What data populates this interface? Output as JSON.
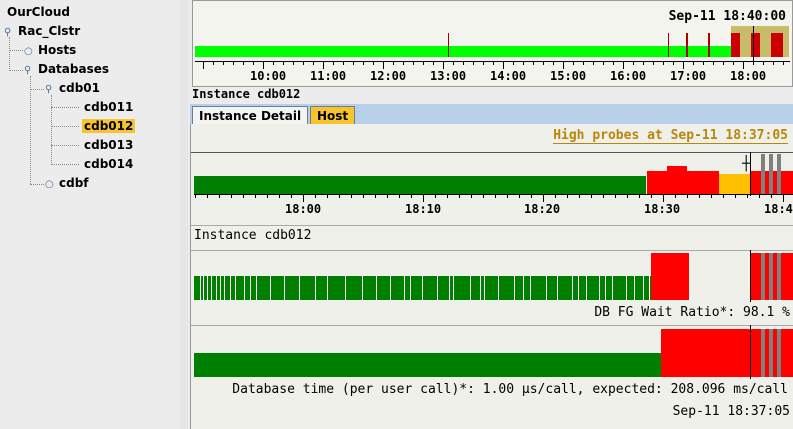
{
  "sidebar": {
    "root": "OurCloud",
    "cluster": "Rac_Clstr",
    "hosts": "Hosts",
    "databases": "Databases",
    "db_group": "cdb01",
    "instances": [
      "cdb011",
      "cdb012",
      "cdb013",
      "cdb014"
    ],
    "selected_instance": "cdb012",
    "other_db": "cdbf"
  },
  "overview": {
    "timestamp": "Sep-11  18:40:00",
    "tick_labels": [
      "10:00",
      "11:00",
      "12:00",
      "13:00",
      "14:00",
      "15:00",
      "16:00",
      "17:00",
      "18:00"
    ]
  },
  "instance_header": "Instance cdb012",
  "tabs": [
    {
      "label": "Instance Detail",
      "active": true
    },
    {
      "label": "Host",
      "active": false
    }
  ],
  "detail": {
    "alert_text": "High probes at Sep-11 18:37:05",
    "tick_labels": [
      "18:00",
      "18:10",
      "18:20",
      "18:30",
      "18:4"
    ],
    "section_title": "Instance cdb012",
    "wait_ratio_text": "DB FG Wait Ratio*: 98.1 %",
    "db_time_text": "Database time (per user call)*: 1.00 μs/call, expected: 208.096 ms/call",
    "bottom_timestamp": "Sep-11  18:37:05"
  },
  "colors": {
    "green_bright": "#00ff00",
    "green_dark": "#008000",
    "red": "#ff0000",
    "dark_red": "#aa0000",
    "orange": "#ffc000",
    "gray": "#808080",
    "highlight": "#f7c52b",
    "tab_bg": "#b8cfe8"
  }
}
